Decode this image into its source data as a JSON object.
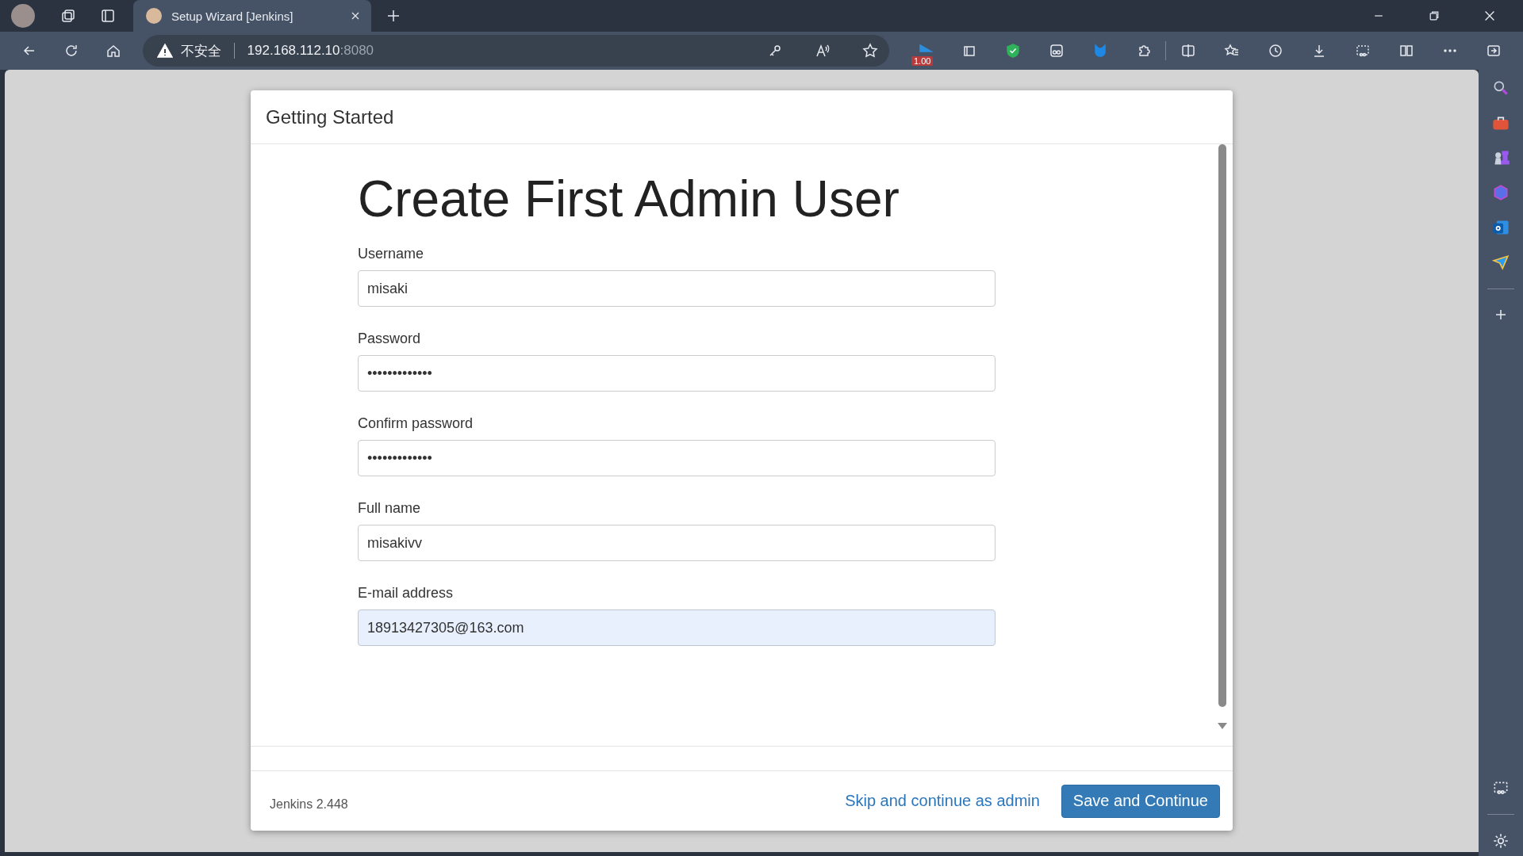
{
  "browser": {
    "tab": {
      "title": "Setup Wizard [Jenkins]",
      "selected": true
    },
    "address": {
      "security": "不安全",
      "host": "192.168.112.10",
      "port": ":8080"
    },
    "extension_badge": "1.00"
  },
  "dialog": {
    "title": "Getting Started",
    "heading": "Create First Admin User",
    "fields": [
      {
        "label": "Username",
        "value": "misaki",
        "autofilled": false
      },
      {
        "label": "Password",
        "value": "•••••••••••••",
        "autofilled": false
      },
      {
        "label": "Confirm password",
        "value": "•••••••••••••",
        "autofilled": false
      },
      {
        "label": "Full name",
        "value": "misakivv",
        "autofilled": false
      },
      {
        "label": "E-mail address",
        "value": "18913427305@163.com",
        "autofilled": true
      }
    ],
    "footer": {
      "version": "Jenkins 2.448",
      "skip_link": "Skip and continue as admin",
      "save_button": "Save and Continue"
    }
  }
}
